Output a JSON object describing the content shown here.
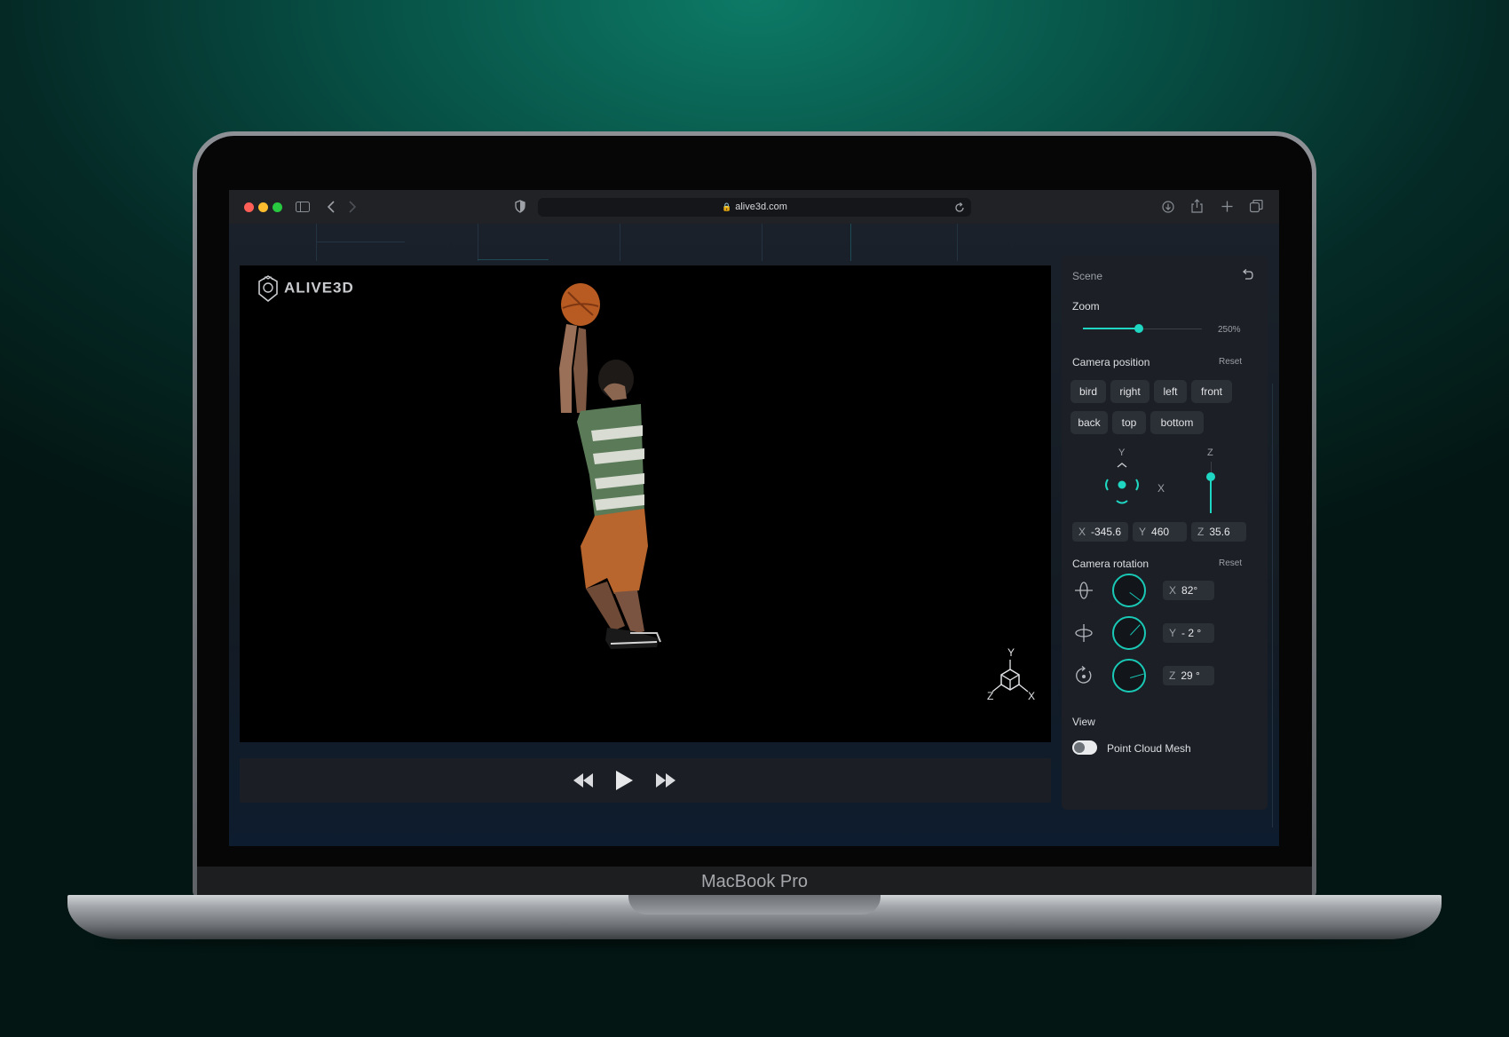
{
  "laptop": {
    "model_label": "MacBook Pro"
  },
  "browser": {
    "url": "alive3d.com",
    "icons": [
      "sidebar-icon",
      "back-icon",
      "forward-icon",
      "shield-icon",
      "lock-icon",
      "reload-icon",
      "download-icon",
      "share-icon",
      "new-tab-icon",
      "tabs-icon"
    ]
  },
  "viewer": {
    "logo_text": "ALIVE3D",
    "gizmo": {
      "y": "Y",
      "z": "Z",
      "x": "X"
    },
    "controls": [
      "rewind-icon",
      "play-icon",
      "fast-forward-icon"
    ]
  },
  "panel": {
    "scene_label": "Scene",
    "zoom": {
      "label": "Zoom",
      "value_label": "250%",
      "level": 0.47
    },
    "camera_position": {
      "label": "Camera position",
      "reset_label": "Reset",
      "presets_row1": [
        "bird",
        "right",
        "left",
        "front"
      ],
      "presets_row2": [
        "back",
        "top",
        "bottom"
      ],
      "axis_y": "Y",
      "axis_x": "X",
      "axis_z": "Z",
      "z_level": 0.3,
      "x": {
        "axis": "X",
        "value": "-345.6"
      },
      "y": {
        "axis": "Y",
        "value": "460"
      },
      "z": {
        "axis": "Z",
        "value": "35.6"
      }
    },
    "camera_rotation": {
      "label": "Camera rotation",
      "reset_label": "Reset",
      "x": {
        "axis": "X",
        "value": "82°",
        "angle": 82
      },
      "y": {
        "axis": "Y",
        "value": "- 2 °",
        "angle": -2
      },
      "z": {
        "axis": "Z",
        "value": "29 °",
        "angle": 29
      }
    },
    "view": {
      "label": "View",
      "toggle_label": "Point Cloud Mesh",
      "toggle_on": false
    }
  },
  "colors": {
    "accent": "#1fd6c3",
    "panel": "#1c1f25",
    "viewport": "#000000"
  }
}
